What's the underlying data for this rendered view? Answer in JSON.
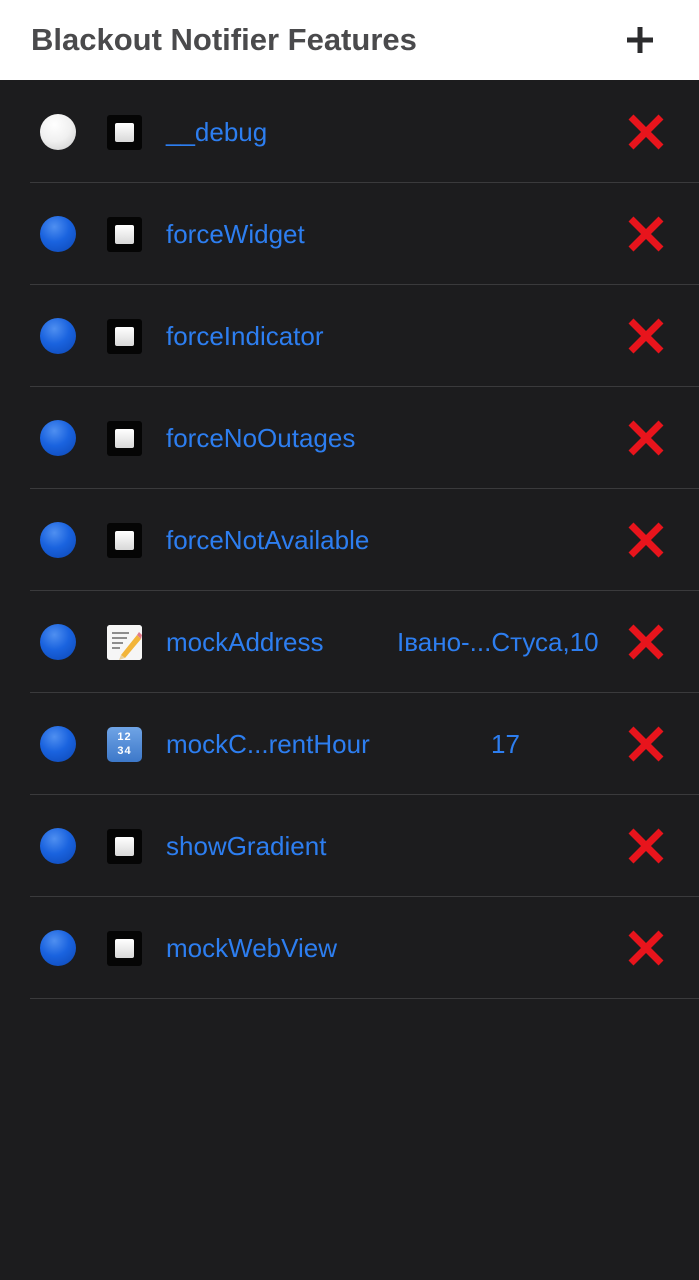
{
  "header": {
    "title": "Blackout Notifier Features",
    "add_icon": "plus-icon"
  },
  "colors": {
    "header_bg": "#ffffff",
    "list_bg": "#1c1c1e",
    "accent": "#2d7ef0",
    "delete": "#e8141c",
    "separator": "#3a3a3c"
  },
  "features": [
    {
      "name": "__debug",
      "status": "white-circle",
      "type_icon": "checkbox-icon",
      "value": "",
      "delete_icon": "cross-mark-icon"
    },
    {
      "name": "forceWidget",
      "status": "blue-circle",
      "type_icon": "checkbox-icon",
      "value": "",
      "delete_icon": "cross-mark-icon"
    },
    {
      "name": "forceIndicator",
      "status": "blue-circle",
      "type_icon": "checkbox-icon",
      "value": "",
      "delete_icon": "cross-mark-icon"
    },
    {
      "name": "forceNoOutages",
      "status": "blue-circle",
      "type_icon": "checkbox-icon",
      "value": "",
      "delete_icon": "cross-mark-icon"
    },
    {
      "name": "forceNotAvailable",
      "status": "blue-circle",
      "type_icon": "checkbox-icon",
      "value": "",
      "delete_icon": "cross-mark-icon"
    },
    {
      "name": "mockAddress",
      "status": "blue-circle",
      "type_icon": "memo-icon",
      "value": "Івано-...Стуса,10",
      "delete_icon": "cross-mark-icon"
    },
    {
      "name": "mockC...rentHour",
      "status": "blue-circle",
      "type_icon": "input-numbers-icon",
      "value": "17",
      "numbers_glyph": "1234",
      "delete_icon": "cross-mark-icon"
    },
    {
      "name": "showGradient",
      "status": "blue-circle",
      "type_icon": "checkbox-icon",
      "value": "",
      "delete_icon": "cross-mark-icon"
    },
    {
      "name": "mockWebView",
      "status": "blue-circle",
      "type_icon": "checkbox-icon",
      "value": "",
      "delete_icon": "cross-mark-icon"
    }
  ]
}
